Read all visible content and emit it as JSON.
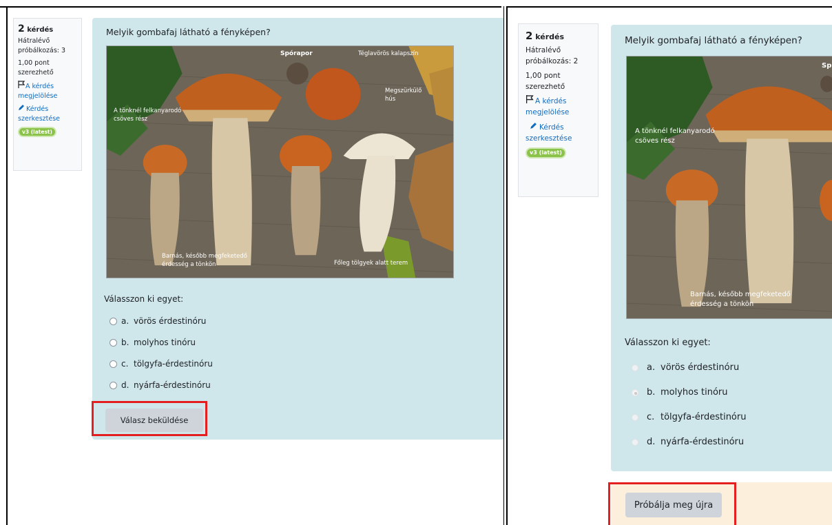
{
  "left": {
    "info": {
      "number": "2",
      "number_label": "kérdés",
      "remaining": "Hátralévő próbálkozás: 3",
      "points_1": "1,00 pont",
      "points_2": "szerezhető",
      "flag_link": "A kérdés megjelölése",
      "edit_link": "Kérdés szerkesztése",
      "version_badge": "v3 (latest)"
    },
    "question_text": "Melyik gombafaj látható a fényképen?",
    "photo_labels": {
      "spore": "Spórapor",
      "cap": "Téglavörös kalapszín",
      "flesh_1": "Megszürkülő",
      "flesh_2": "hús",
      "tube_1": "A tönknél felkanyarodó",
      "tube_2": "csöves rész",
      "stem_1": "Barnás, később megfeketedő",
      "stem_2": "érdesség a tönkön",
      "oak": "Főleg tölgyek alatt terem"
    },
    "prompt": "Válasszon ki egyet:",
    "options": [
      {
        "letter": "a.",
        "label": "vörös érdestinóru"
      },
      {
        "letter": "b.",
        "label": "molyhos tinóru"
      },
      {
        "letter": "c.",
        "label": "tölgyfa-érdestinóru"
      },
      {
        "letter": "d.",
        "label": "nyárfa-érdestinóru"
      }
    ],
    "submit_label": "Válasz beküldése"
  },
  "right": {
    "info": {
      "number": "2",
      "number_label": "kérdés",
      "remaining_1": "Hátralévő",
      "remaining_2": "próbálkozás: 2",
      "points_1": "1,00 pont",
      "points_2": "szerezhető",
      "flag_1": "A kérdés",
      "flag_2": "megjelölése",
      "edit_1": "Kérdés",
      "edit_2": "szerkesztése",
      "version_badge": "v3 (latest)"
    },
    "question_text": "Melyik gombafaj látható a fényképen?",
    "photo_labels": {
      "spore_partial": "Sp",
      "tube_1": "A tönknél felkanyarodó",
      "tube_2": "csöves rész",
      "stem_1": "Barnás, később megfeketedő",
      "stem_2": "érdesség a tönkön"
    },
    "prompt": "Válasszon ki egyet:",
    "options": [
      {
        "letter": "a.",
        "label": "vörös érdestinóru"
      },
      {
        "letter": "b.",
        "label": "molyhos tinóru"
      },
      {
        "letter": "c.",
        "label": "tölgyfa-érdestinóru"
      },
      {
        "letter": "d.",
        "label": "nyárfa-érdestinóru"
      }
    ],
    "selected_option": "b.",
    "retry_label": "Próbálja meg újra"
  },
  "colors": {
    "panel_bg": "#cfe6ea",
    "link": "#0f6cbf",
    "badge": "#8bc34a",
    "highlight_box": "#e41f1f",
    "button_bg": "#ced4da",
    "feedback_bg": "#fcefdc"
  }
}
